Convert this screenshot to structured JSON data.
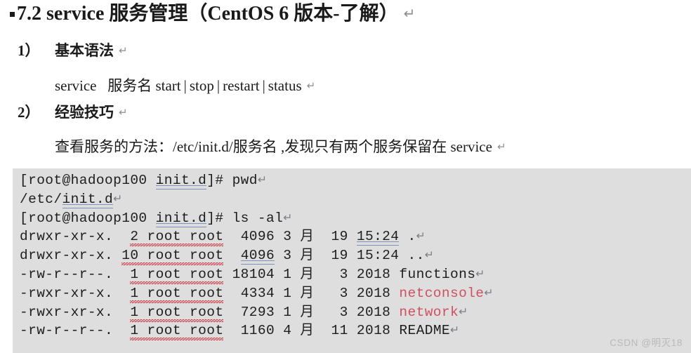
{
  "document": {
    "heading": "7.2 service  服务管理（CentOS 6 版本-了解）",
    "return_mark": "↵",
    "items": [
      {
        "number": "1）",
        "title": "基本语法",
        "body_parts": {
          "command": "service",
          "arg": "服务名",
          "opt1": "start",
          "opt2": "stop",
          "opt3": "restart",
          "opt4": "status",
          "separator": "|"
        }
      },
      {
        "number": "2）",
        "title": "经验技巧",
        "body": "查看服务的方法：/etc/init.d/服务名    ,发现只有两个服务保留在 service"
      }
    ]
  },
  "terminal": {
    "background_color": "#dedede",
    "highlight_color": "#d0505e",
    "spellcheck_underline_color": "#c8303c",
    "grammar_underline_color": "#8091b8",
    "lines": [
      {
        "id": "prompt-pwd",
        "prefix": "[root@hadoop100 ",
        "path": "init.d",
        "suffix": "]# pwd",
        "kind": "prompt"
      },
      {
        "id": "output-pwd",
        "prefix": "/etc/",
        "path": "init.d",
        "suffix": "",
        "kind": "output"
      },
      {
        "id": "prompt-ls",
        "prefix": "[root@hadoop100 ",
        "path": "init.d",
        "suffix": "]# ls -al",
        "kind": "prompt"
      }
    ],
    "listing": [
      {
        "perms": "drwxr-xr-x.",
        "links": "2",
        "owner": "root",
        "group": "root",
        "size": "4096",
        "month": "3 月",
        "day": "19",
        "time": "15:24",
        "name": ".",
        "name_color": "default"
      },
      {
        "perms": "drwxr-xr-x.",
        "links": "10",
        "owner": "root",
        "group": "root",
        "size": "4096",
        "month": "3 月",
        "day": "19",
        "time": "15:24",
        "name": "..",
        "name_color": "default"
      },
      {
        "perms": "-rw-r--r--.",
        "links": "1",
        "owner": "root",
        "group": "root",
        "size": "18104",
        "month": "1 月",
        "day": "3",
        "time": "2018",
        "name": "functions",
        "name_color": "default"
      },
      {
        "perms": "-rwxr-xr-x.",
        "links": "1",
        "owner": "root",
        "group": "root",
        "size": "4334",
        "month": "1 月",
        "day": "3",
        "time": "2018",
        "name": "netconsole",
        "name_color": "red"
      },
      {
        "perms": "-rwxr-xr-x.",
        "links": "1",
        "owner": "root",
        "group": "root",
        "size": "7293",
        "month": "1 月",
        "day": "3",
        "time": "2018",
        "name": "network",
        "name_color": "red"
      },
      {
        "perms": "-rw-r--r--.",
        "links": "1",
        "owner": "root",
        "group": "root",
        "size": "1160",
        "month": "4 月",
        "day": "11",
        "time": "2018",
        "name": "README",
        "name_color": "default"
      }
    ]
  },
  "watermark": "CSDN @明灭18"
}
